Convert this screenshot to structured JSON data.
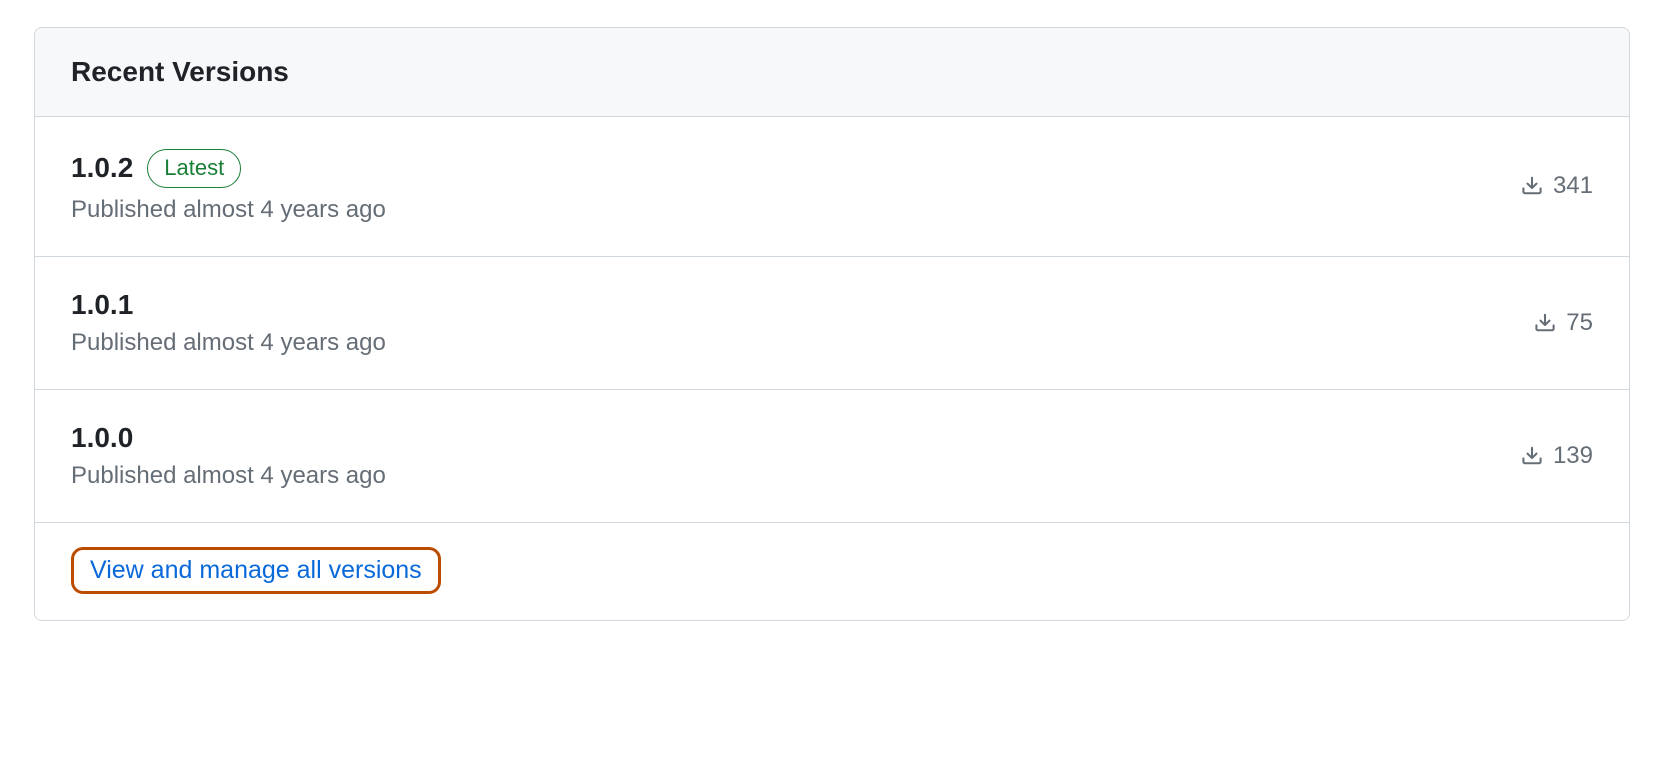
{
  "panel": {
    "title": "Recent Versions",
    "versions": [
      {
        "number": "1.0.2",
        "badge": "Latest",
        "meta": "Published almost 4 years ago",
        "downloads": "341"
      },
      {
        "number": "1.0.1",
        "badge": null,
        "meta": "Published almost 4 years ago",
        "downloads": "75"
      },
      {
        "number": "1.0.0",
        "badge": null,
        "meta": "Published almost 4 years ago",
        "downloads": "139"
      }
    ],
    "footer_link": "View and manage all versions"
  }
}
